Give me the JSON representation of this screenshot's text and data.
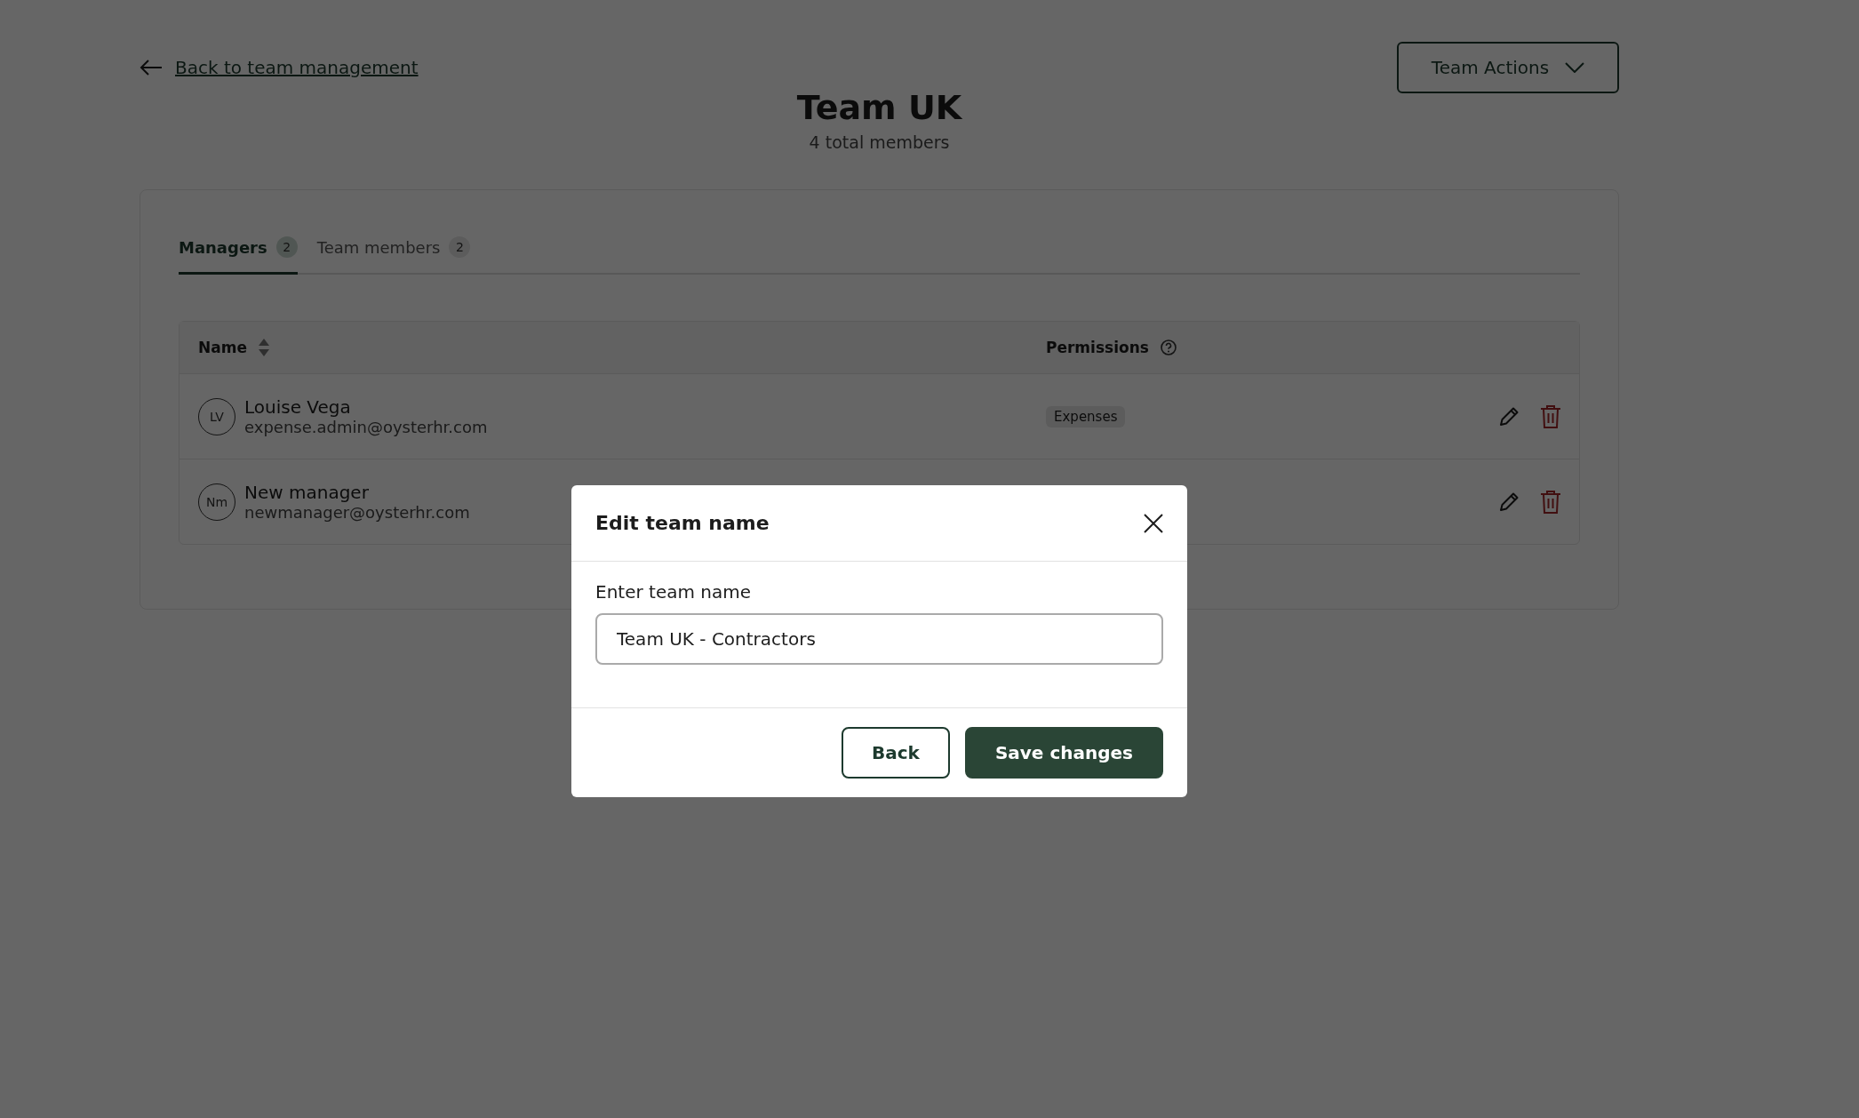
{
  "back_link": {
    "label": "Back to team management"
  },
  "actions_button": {
    "label": "Team Actions"
  },
  "title": "Team UK",
  "subtitle": "4 total members",
  "tabs": [
    {
      "label": "Managers",
      "count": "2",
      "selected": true
    },
    {
      "label": "Team members",
      "count": "2",
      "selected": false
    }
  ],
  "table": {
    "columns": [
      {
        "label": "Name",
        "kind": "sortable"
      },
      {
        "label": "Permissions",
        "kind": "help"
      }
    ],
    "rows": [
      {
        "initials": "LV",
        "name": "Louise Vega",
        "email": "expense.admin@oysterhr.com",
        "permissions": [
          "Expenses"
        ]
      },
      {
        "initials": "Nm",
        "name": "New manager",
        "email": "newmanager@oysterhr.com"
      }
    ]
  },
  "dialog": {
    "title": "Edit team name",
    "field_label": "Enter team name",
    "value": "Team UK - Contractors",
    "buttons": [
      {
        "label": "Back",
        "kind": "secondary"
      },
      {
        "label": "Save changes",
        "kind": "primary"
      }
    ]
  }
}
